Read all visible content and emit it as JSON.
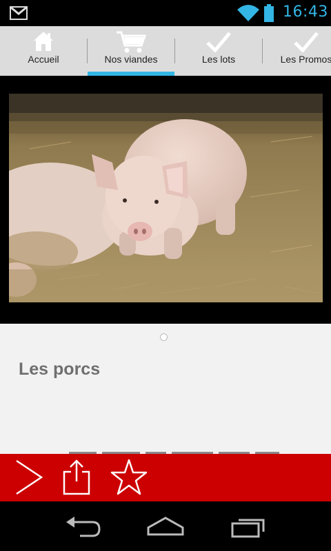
{
  "status_bar": {
    "time": "16:43",
    "icons": [
      "gmail-icon",
      "wifi-icon",
      "battery-icon"
    ]
  },
  "tabs": [
    {
      "label": "Accueil",
      "icon": "home-icon",
      "active": false
    },
    {
      "label": "Nos viandes",
      "icon": "cart-icon",
      "active": true
    },
    {
      "label": "Les lots",
      "icon": "check-icon",
      "active": false
    },
    {
      "label": "Les Promos",
      "icon": "check-icon",
      "active": false
    }
  ],
  "content": {
    "image": "pig-photo",
    "page_indicator": {
      "count": 1,
      "current": 1
    },
    "title": "Les porcs"
  },
  "action_bar": {
    "buttons": [
      "next-arrow-icon",
      "share-icon",
      "favorite-star-icon"
    ]
  },
  "nav_bar": {
    "buttons": [
      "back-icon",
      "home-icon",
      "recent-apps-icon"
    ]
  },
  "colors": {
    "accent": "#33b5e5",
    "action_bar": "#cc0000",
    "tab_bar": "#dcdcdc",
    "title": "#6f6f6f"
  }
}
